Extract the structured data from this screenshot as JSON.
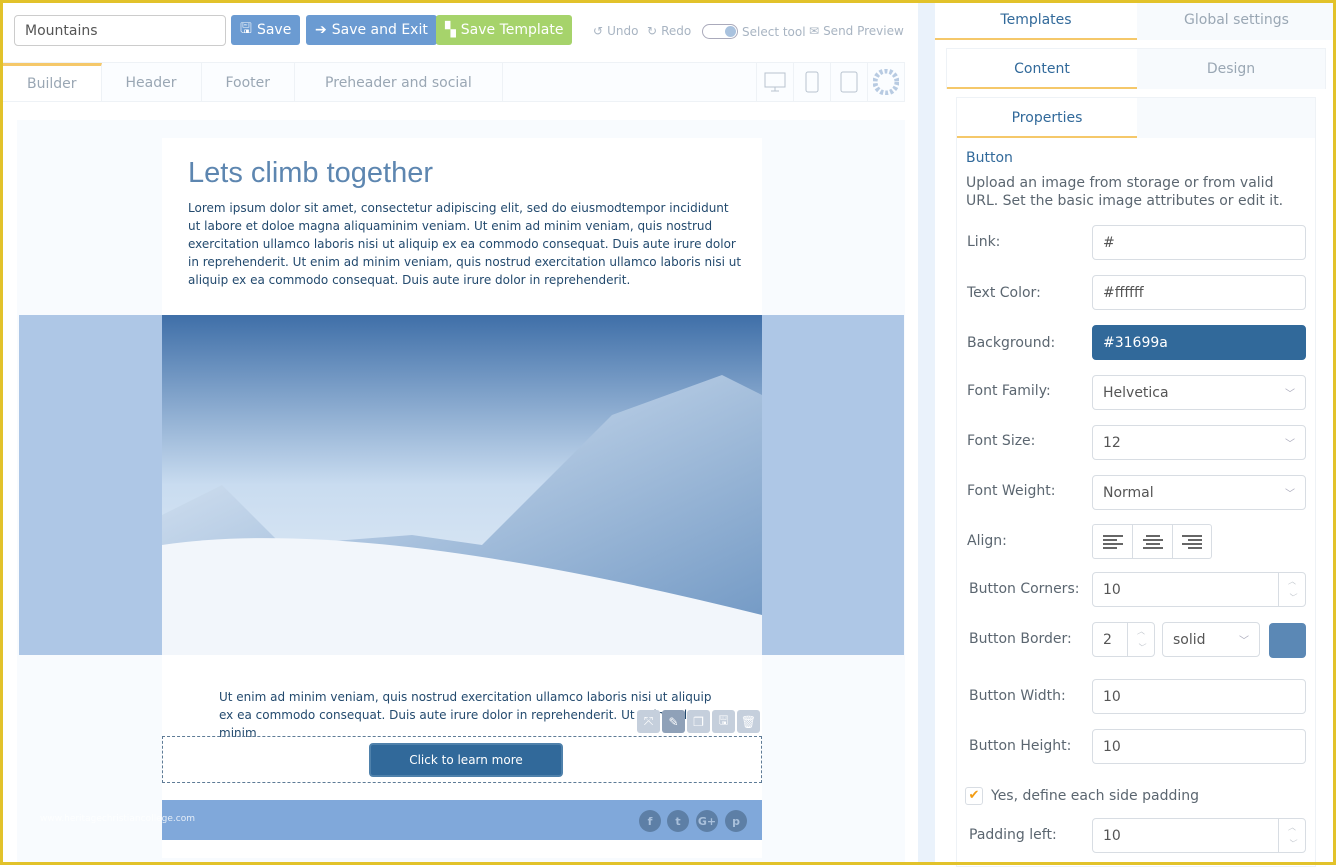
{
  "toolbar": {
    "template_name": "Mountains",
    "save": "Save",
    "save_exit": "Save and Exit",
    "save_template": "Save Template",
    "undo": "Undo",
    "redo": "Redo",
    "select_tool": "Select tool",
    "send_preview": "Send Preview"
  },
  "tabs": [
    "Builder",
    "Header",
    "Footer",
    "Preheader and social"
  ],
  "email": {
    "title": "Lets climb together",
    "intro": "Lorem ipsum dolor sit amet, consectetur adipiscing elit, sed do eiusmodtempor incididunt ut labore et doloe magna aliquaminim veniam. Ut enim ad minim veniam, quis nostrud exercitation ullamco laboris nisi ut aliquip ex ea commodo consequat. Duis aute irure dolor in reprehenderit. Ut enim ad minim veniam, quis nostrud exercitation ullamco laboris nisi ut aliquip ex ea commodo consequat. Duis aute irure dolor in reprehenderit.",
    "body": "Ut enim ad minim veniam, quis nostrud exercitation ullamco laboris nisi ut aliquip ex ea commodo consequat. Duis aute irure dolor in reprehenderit. Ut enim ad minim",
    "cta": "Click to learn more",
    "social": [
      "f",
      "t",
      "G+",
      "p"
    ]
  },
  "watermark": "www.heritagechristiancollege.com",
  "panel": {
    "tabs1": [
      "Templates",
      "Global settings"
    ],
    "tabs2": [
      "Content",
      "Design"
    ],
    "tab3": "Properties",
    "section": "Button",
    "description": "Upload an image from storage or from valid URL. Set the basic image attributes or edit it.",
    "fields": {
      "link_label": "Link:",
      "link": "#",
      "text_color_label": "Text Color:",
      "text_color": "#ffffff",
      "background_label": "Background:",
      "background": "#31699a",
      "font_family_label": "Font Family:",
      "font_family": "Helvetica",
      "font_size_label": "Font Size:",
      "font_size": "12",
      "font_weight_label": "Font Weight:",
      "font_weight": "Normal",
      "align_label": "Align:",
      "corners_label": "Button Corners:",
      "corners": "10",
      "border_label": "Button Border:",
      "border_width": "2",
      "border_style": "solid",
      "border_color": "#5b88b5",
      "width_label": "Button Width:",
      "width": "10",
      "height_label": "Button Height:",
      "height": "10",
      "padding_check": "Yes, define each side padding",
      "padding_left_label": "Padding left:",
      "padding_left": "10"
    }
  },
  "colors": {
    "accent": "#f5c86a",
    "primary": "#6b9bd2",
    "green": "#a6d36b",
    "frame": "#e2c22a"
  }
}
